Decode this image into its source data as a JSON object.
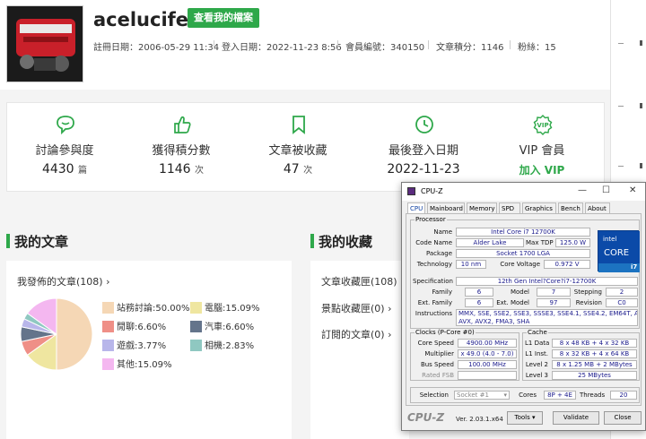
{
  "profile": {
    "username": "acelucifer",
    "view_profile_button": "查看我的檔案",
    "meta": [
      "註冊日期：2006-05-29 11:34",
      "登入日期：2022-11-23 8:56",
      "會員編號：340150",
      "文章積分：1146",
      "粉絲：15"
    ]
  },
  "stats": [
    {
      "icon": "chat-bubble-icon",
      "label": "討論參與度",
      "value": "4430",
      "unit": "篇"
    },
    {
      "icon": "thumbs-up-icon",
      "label": "獲得積分數",
      "value": "1146",
      "unit": "次"
    },
    {
      "icon": "bookmark-icon",
      "label": "文章被收藏",
      "value": "47",
      "unit": "次"
    },
    {
      "icon": "clock-icon",
      "label": "最後登入日期",
      "value": "2022-11-23",
      "unit": ""
    },
    {
      "icon": "vip-badge-icon",
      "label": "VIP 會員",
      "value": "加入 VIP",
      "unit": ""
    }
  ],
  "my_articles": {
    "title": "我的文章",
    "posts_link": "我發佈的文章(108) ›",
    "legend": [
      {
        "label": "站務討論:50.00%",
        "color": "#f5d7b5"
      },
      {
        "label": "電腦:15.09%",
        "color": "#efe6a0"
      },
      {
        "label": "閒聊:6.60%",
        "color": "#ef8f87"
      },
      {
        "label": "汽車:6.60%",
        "color": "#64748b"
      },
      {
        "label": "遊戲:3.77%",
        "color": "#b8b6ea"
      },
      {
        "label": "相機:2.83%",
        "color": "#8fc8c1"
      },
      {
        "label": "其他:15.09%",
        "color": "#f4b7f0"
      }
    ]
  },
  "chart_data": {
    "type": "pie",
    "slices": [
      {
        "name": "站務討論",
        "value": 50.0,
        "color": "#f5d7b5"
      },
      {
        "name": "電腦",
        "value": 15.09,
        "color": "#efe6a0"
      },
      {
        "name": "閒聊",
        "value": 6.6,
        "color": "#ef8f87"
      },
      {
        "name": "汽車",
        "value": 6.6,
        "color": "#64748b"
      },
      {
        "name": "遊戲",
        "value": 3.77,
        "color": "#b8b6ea"
      },
      {
        "name": "相機",
        "value": 2.83,
        "color": "#8fc8c1"
      },
      {
        "name": "其他",
        "value": 15.09,
        "color": "#f4b7f0"
      }
    ]
  },
  "my_favorites": {
    "title": "我的收藏",
    "links": [
      "文章收藏匣(108) ›",
      "景點收藏匣(0) ›",
      "訂閱的文章(0) ›"
    ]
  },
  "cpuz": {
    "title": "CPU-Z",
    "tabs": [
      "CPU",
      "Mainboard",
      "Memory",
      "SPD",
      "Graphics",
      "Bench",
      "About"
    ],
    "processor_group": "Processor",
    "name_label": "Name",
    "name": "Intel Core i7 12700K",
    "codename_label": "Code Name",
    "codename": "Alder Lake",
    "maxtdp_label": "Max TDP",
    "maxtdp": "125.0 W",
    "package_label": "Package",
    "package": "Socket 1700 LGA",
    "technology_label": "Technology",
    "technology": "10 nm",
    "corevoltage_label": "Core Voltage",
    "corevoltage": "0.972 V",
    "spec_label": "Specification",
    "spec": "12th Gen Intel?Core?i7-12700K",
    "family_label": "Family",
    "family": "6",
    "model_label": "Model",
    "model": "7",
    "stepping_label": "Stepping",
    "stepping": "2",
    "extfamily_label": "Ext. Family",
    "extfamily": "6",
    "extmodel_label": "Ext. Model",
    "extmodel": "97",
    "revision_label": "Revision",
    "revision": "C0",
    "instr_label": "Instructions",
    "instr_line1": "MMX, SSE, SSE2, SSE3, SSSE3, SSE4.1, SSE4.2, EM64T, AES,",
    "instr_line2": "AVX, AVX2, FMA3, SHA",
    "clocks_group": "Clocks (P-Core #0)",
    "corespeed_label": "Core Speed",
    "corespeed": "4900.00 MHz",
    "multiplier_label": "Multiplier",
    "multiplier": "x 49.0 (4.0 - 7.0)",
    "busspeed_label": "Bus Speed",
    "busspeed": "100.00 MHz",
    "ratedfsb_label": "Rated FSB",
    "ratedfsb": "",
    "cache_group": "Cache",
    "l1data_label": "L1 Data",
    "l1data": "8 x 48 KB + 4 x 32 KB",
    "l1inst_label": "L1 Inst.",
    "l1inst": "8 x 32 KB + 4 x 64 KB",
    "level2_label": "Level 2",
    "level2": "8 x 1.25 MB + 2 MBytes",
    "level3_label": "Level 3",
    "level3": "25 MBytes",
    "selection_label": "Selection",
    "selection": "Socket #1",
    "cores_label": "Cores",
    "cores": "8P + 4E",
    "threads_label": "Threads",
    "threads": "20",
    "brand": "CPU-Z",
    "version": "Ver. 2.03.1.x64",
    "tools_button": "Tools",
    "validate_button": "Validate",
    "close_button": "Close",
    "intel_badge": {
      "brand": "intel",
      "core": "CORE",
      "tier": "i7"
    }
  },
  "colors": {
    "accent": "#2ea84a",
    "cpuz_value": "#1a1a8c",
    "intel_blue": "#0b4aa8"
  }
}
